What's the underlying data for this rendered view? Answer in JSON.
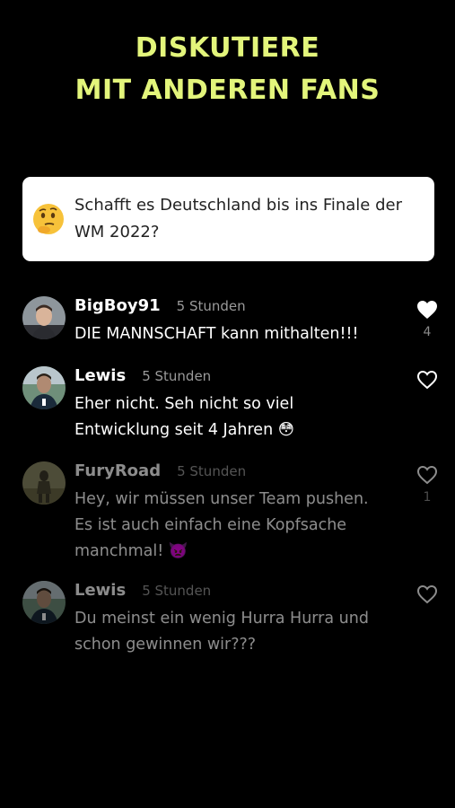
{
  "headline": {
    "line1": "DISKUTIERE",
    "line2": "MIT ANDEREN FANS"
  },
  "question": {
    "emoji": "thinking-face-emoji",
    "text": "Schafft es Deutschland bis ins Finale der WM 2022?"
  },
  "comments": [
    {
      "name": "BigBoy91",
      "time": "5 Stunden",
      "text": "DIE MANNSCHAFT kann mithalten!!!",
      "liked": true,
      "likes": "4"
    },
    {
      "name": "Lewis",
      "time": "5 Stunden",
      "text": "Eher nicht. Seh nicht so viel Entwicklung seit 4 Jahren 😳",
      "liked": false,
      "likes": ""
    },
    {
      "name": "FuryRoad",
      "time": "5 Stunden",
      "text": "Hey, wir müssen unser Team pushen. Es ist auch einfach eine Kopfsache manchmal! 👿",
      "liked": false,
      "likes": "1"
    },
    {
      "name": "Lewis",
      "time": "5 Stunden",
      "text": "Du meinst ein wenig Hurra Hurra und schon gewinnen wir???",
      "liked": false,
      "likes": ""
    }
  ],
  "colors": {
    "accent": "#e3f57b",
    "background": "#000000",
    "card": "#ffffff"
  }
}
